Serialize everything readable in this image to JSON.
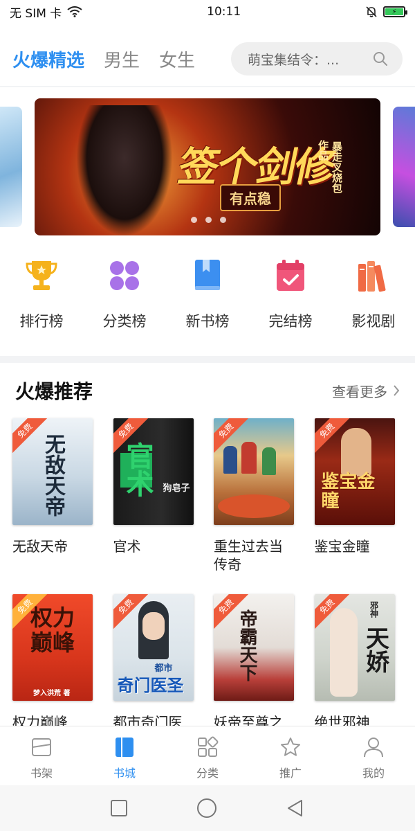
{
  "status_bar": {
    "carrier": "无 SIM 卡",
    "time": "10:11",
    "battery_level": 1.0
  },
  "top_tabs": [
    {
      "label": "火爆精选",
      "active": true
    },
    {
      "label": "男生",
      "active": false
    },
    {
      "label": "女生",
      "active": false
    }
  ],
  "search": {
    "placeholder": "萌宝集结令：..."
  },
  "banner": {
    "title": "签个剑修",
    "subtitle": "有点稳",
    "author_line1": "暴走叉烧包",
    "author_line2": "作品",
    "page_count": 3
  },
  "quick_nav": [
    {
      "label": "排行榜",
      "icon": "trophy-icon"
    },
    {
      "label": "分类榜",
      "icon": "category-icon"
    },
    {
      "label": "新书榜",
      "icon": "book-icon"
    },
    {
      "label": "完结榜",
      "icon": "calendar-check-icon"
    },
    {
      "label": "影视剧",
      "icon": "books-icon"
    }
  ],
  "section": {
    "title": "火爆推荐",
    "more_label": "查看更多"
  },
  "books_row1": [
    {
      "title": "无敌天帝",
      "badge": "免费",
      "cover_text": "无敌天帝"
    },
    {
      "title": "官术",
      "badge": "免费",
      "cover_text": "官术",
      "cover_author": "狗皂子"
    },
    {
      "title": "重生过去当传奇",
      "badge": "免费",
      "cover_text": ""
    },
    {
      "title": "鉴宝金瞳",
      "badge": "免费",
      "cover_text": "鉴宝金瞳"
    }
  ],
  "books_row2": [
    {
      "title": "权力巅峰",
      "badge": "免费",
      "cover_text": "权力巅峰",
      "cover_author": "梦入洪荒 著"
    },
    {
      "title": "都市奇门医",
      "badge": "免费",
      "cover_text": "奇门医圣",
      "cover_small": "都市"
    },
    {
      "title": "妖帝至尊之",
      "badge": "免费",
      "cover_text": "帝霸天下"
    },
    {
      "title": "绝世邪神",
      "badge": "免费",
      "cover_text": "天娇",
      "cover_small": "邪神"
    }
  ],
  "bottom_nav": [
    {
      "label": "书架",
      "icon": "bookshelf-icon",
      "active": false
    },
    {
      "label": "书城",
      "icon": "bookstore-icon",
      "active": true
    },
    {
      "label": "分类",
      "icon": "category-grid-icon",
      "active": false
    },
    {
      "label": "推广",
      "icon": "star-icon",
      "active": false
    },
    {
      "label": "我的",
      "icon": "user-icon",
      "active": false
    }
  ],
  "colors": {
    "accent": "#2e8ff0",
    "ribbon": "#ef5b3b",
    "trophy": "#f5b21c",
    "category": "#a872e8",
    "newbook": "#3c8ff0",
    "finished": "#f0567a",
    "drama": "#f06a44"
  }
}
